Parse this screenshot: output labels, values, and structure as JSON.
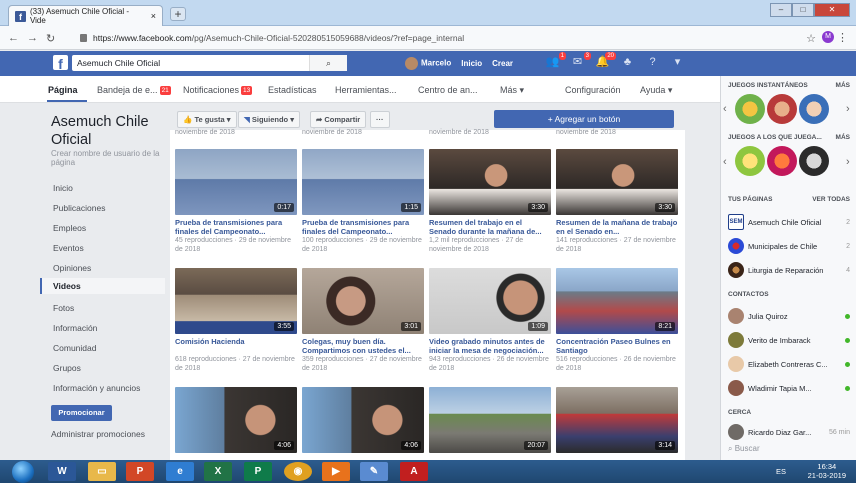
{
  "browser": {
    "tab_title": "(33) Asemuch Chile Oficial - Vide",
    "tab_close": "×",
    "new_tab": "+",
    "url_host": "https://www.facebook.com",
    "url_path": "/pg/Asemuch-Chile-Oficial-520280515059688/videos/?ref=page_internal",
    "profile_letter": "M"
  },
  "fb": {
    "search_value": "Asemuch Chile Oficial",
    "user": "Marcelo",
    "home": "Inicio",
    "create": "Crear",
    "badges": {
      "friends": "1",
      "messages": "3",
      "notifications": "20"
    }
  },
  "pagenav": {
    "pagina": "Página",
    "inbox": "Bandeja de e...",
    "inbox_badge": "21",
    "notifications": "Notificaciones",
    "notifications_badge": "13",
    "stats": "Estadísticas",
    "tools": "Herramientas...",
    "centro": "Centro de an...",
    "mas": "Más ▾",
    "config": "Configuración",
    "help": "Ayuda ▾"
  },
  "left": {
    "page_name": "Asemuch Chile Oficial",
    "username_link": "Crear nombre de usuario de la página",
    "nav": [
      "Inicio",
      "Publicaciones",
      "Empleos",
      "Eventos",
      "Opiniones",
      "Videos",
      "Fotos",
      "Información",
      "Comunidad",
      "Grupos",
      "Información y anuncios"
    ],
    "promote": "Promocionar",
    "admin_promos": "Administrar promociones"
  },
  "actions": {
    "like": "Te gusta ▾",
    "following": "Siguiendo ▾",
    "share": "Compartir",
    "more": "···",
    "add_button": "+ Agregar un botón"
  },
  "videos_top_meta": [
    "noviembre de 2018",
    "noviembre de 2018",
    "noviembre de 2018",
    "noviembre de 2018"
  ],
  "videos": [
    {
      "duration": "0:17",
      "title": "Prueba de transmisiones para finales del Campeonato...",
      "meta": "45 reproducciones · 29 de noviembre de 2018"
    },
    {
      "duration": "1:15",
      "title": "Prueba de transmisiones para finales del Campeonato...",
      "meta": "100 reproducciones · 29 de noviembre de 2018"
    },
    {
      "duration": "3:30",
      "title": "Resumen del trabajo en el Senado durante la mañana de...",
      "meta": "1,2 mil reproducciones · 27 de noviembre de 2018"
    },
    {
      "duration": "3:30",
      "title": "Resumen de la mañana de trabajo en el Senado en...",
      "meta": "141 reproducciones · 27 de noviembre de 2018"
    },
    {
      "duration": "3:55",
      "title": "Comisión Hacienda",
      "meta": "618 reproducciones · 27 de noviembre de 2018"
    },
    {
      "duration": "3:01",
      "title": "Colegas, muy buen día. Compartimos con ustedes el...",
      "meta": "359 reproducciones · 27 de noviembre de 2018"
    },
    {
      "duration": "1:09",
      "title": "Video grabado minutos antes de iniciar la mesa de negociación...",
      "meta": "943 reproducciones · 26 de noviembre de 2018"
    },
    {
      "duration": "8:21",
      "title": "Concentración Paseo Bulnes en Santiago",
      "meta": "516 reproducciones · 26 de noviembre de 2018"
    },
    {
      "duration": "4:06",
      "title": "",
      "meta": ""
    },
    {
      "duration": "4:06",
      "title": "",
      "meta": ""
    },
    {
      "duration": "20:07",
      "title": "",
      "meta": ""
    },
    {
      "duration": "3:14",
      "title": "",
      "meta": ""
    }
  ],
  "right": {
    "games_header": "JUEGOS INSTANTÁNEOS",
    "games_more": "MÁS",
    "played_header": "JUEGOS A LOS QUE JUEGA...",
    "played_more": "MÁS",
    "pages_header": "TUS PÁGINAS",
    "pages_all": "VER TODAS",
    "pages": [
      "Asemuch Chile Oficial",
      "Municipales de Chile",
      "Liturgia de Reparación"
    ],
    "page_counts": [
      "2",
      "2",
      "4"
    ],
    "contacts_header": "CONTACTOS",
    "contacts": [
      "Julia Quiroz",
      "Verito de Imbarack",
      "Elizabeth Contreras C...",
      "Wladimir Tapia M..."
    ],
    "near_header": "CERCA",
    "near": "Ricardo Diaz Gar...",
    "near_time": "56 min",
    "search": "Buscar"
  },
  "taskbar": {
    "lang": "ES",
    "time": "16:34",
    "date": "21-03-2019"
  }
}
